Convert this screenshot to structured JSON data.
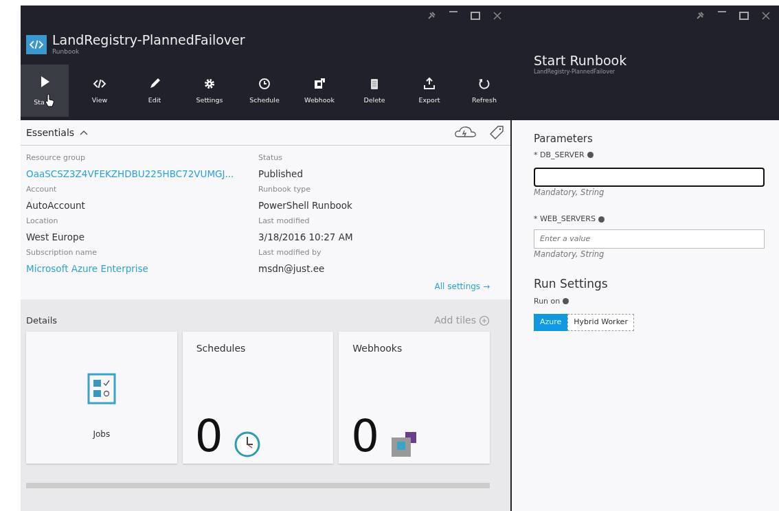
{
  "runbook_blade": {
    "title": "LandRegistry-PlannedFailover",
    "subtitle": "Runbook",
    "toolbar": [
      {
        "label": "Sta",
        "selected": true
      },
      {
        "label": "View",
        "selected": false
      },
      {
        "label": "Edit",
        "selected": false
      },
      {
        "label": "Settings",
        "selected": false
      },
      {
        "label": "Schedule",
        "selected": false
      },
      {
        "label": "Webhook",
        "selected": false
      },
      {
        "label": "Delete",
        "selected": false
      },
      {
        "label": "Export",
        "selected": false
      },
      {
        "label": "Refresh",
        "selected": false
      }
    ],
    "essentials": {
      "title": "Essentials",
      "expanded": true,
      "left": [
        {
          "label": "Resource group",
          "value": "OaaSCSZ3Z4VFEKZHDBU225HBC72VUMGJ...",
          "link": true
        },
        {
          "label": "Account",
          "value": "AutoAccount",
          "link": false
        },
        {
          "label": "Location",
          "value": "West Europe",
          "link": false
        },
        {
          "label": "Subscription name",
          "value": "Microsoft Azure Enterprise",
          "link": true
        }
      ],
      "right": [
        {
          "label": "Status",
          "value": "Published",
          "link": false
        },
        {
          "label": "Runbook type",
          "value": "PowerShell Runbook",
          "link": false
        },
        {
          "label": "Last modified",
          "value": "3/18/2016 10:27 AM",
          "link": false
        },
        {
          "label": "Last modified by",
          "value": "msdn@just.ee",
          "link": false
        }
      ],
      "all_settings": "All settings →"
    },
    "details": {
      "title": "Details",
      "add_tiles": "Add tiles",
      "tiles": [
        {
          "kind": "jobs",
          "title": "Jobs"
        },
        {
          "kind": "schedules",
          "title": "Schedules",
          "count": "0"
        },
        {
          "kind": "webhooks",
          "title": "Webhooks",
          "count": "0"
        }
      ]
    }
  },
  "start_blade": {
    "title": "Start Runbook",
    "subtitle": "LandRegistry-PlannedFailover",
    "parameters_title": "Parameters",
    "parameters": [
      {
        "name": "* DB_SERVER",
        "focused": true,
        "hint": "Mandatory, String"
      },
      {
        "name": "* WEB_SERVERS",
        "focused": false,
        "placeholder": "Enter a value",
        "hint": "Mandatory, String"
      }
    ],
    "run_settings_title": "Run Settings",
    "run_on_label": "Run on",
    "run_on": [
      {
        "label": "Azure",
        "selected": true
      },
      {
        "label": "Hybrid Worker",
        "selected": false
      }
    ]
  }
}
